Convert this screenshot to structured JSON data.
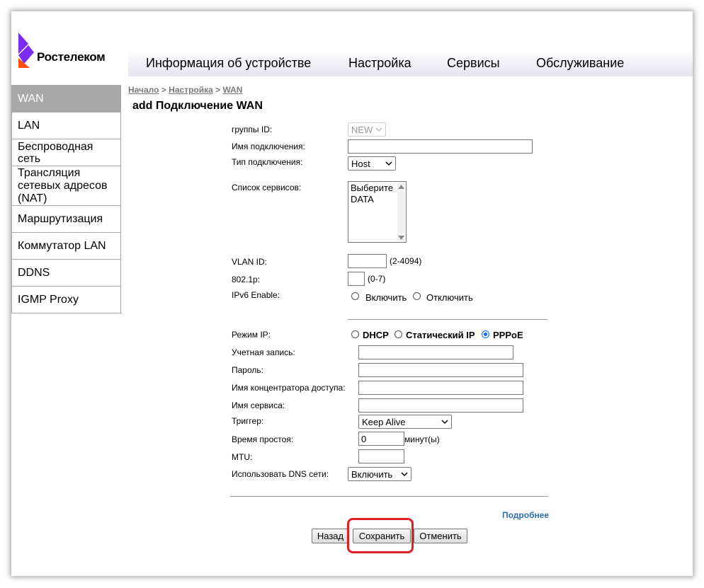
{
  "brand": {
    "name": "Ростелеком",
    "accent": "#7B2CF0",
    "secondary": "#FF4F12"
  },
  "topnav": [
    "Информация об устройстве",
    "Настройка",
    "Сервисы",
    "Обслуживание"
  ],
  "sidebar": [
    "WAN",
    "LAN",
    "Беспроводная сеть",
    "Трансляция сетевых адресов (NAT)",
    "Маршрутизация",
    "Коммутатор LAN",
    "DDNS",
    "IGMP Proxy"
  ],
  "breadcrumb": {
    "home": "Начало",
    "sep1": " > ",
    "settings": "Настройка",
    "sep2": " > ",
    "current": "WAN"
  },
  "page_title": "add Подключение WAN",
  "form": {
    "group_id_label": "группы ID:",
    "group_id_value": "NEW",
    "conn_name_label": "Имя подключения:",
    "conn_name_value": "",
    "conn_type_label": "Тип подключения:",
    "conn_type_value": "Host",
    "service_list_label": "Список сервисов:",
    "service_list_options": [
      "Выберите",
      "DATA"
    ],
    "vlan_label": "VLAN ID:",
    "vlan_value": "",
    "vlan_hint": "(2-4094)",
    "p8021_label": "802.1p:",
    "p8021_value": "",
    "p8021_hint": "(0-7)",
    "ipv6_label": "IPv6 Enable:",
    "ipv6_on": "Включить",
    "ipv6_off": "Отключить",
    "ip_mode_label": "Режим IP:",
    "ip_mode_options": [
      "DHCP",
      "Статический IP",
      "PPPoE"
    ],
    "ip_mode_selected": "PPPoE",
    "account_label": "Учетная запись:",
    "password_label": "Пароль:",
    "ac_name_label": "Имя концентратора доступа:",
    "service_name_label": "Имя сервиса:",
    "trigger_label": "Триггер:",
    "trigger_value": "Keep Alive",
    "idle_label": "Время простоя:",
    "idle_value": "0",
    "idle_unit": "минут(ы)",
    "mtu_label": "MTU:",
    "mtu_value": "",
    "dns_label": "Использовать DNS сети:",
    "dns_value": "Включить"
  },
  "more_link": "Подробнее",
  "buttons": {
    "back": "Назад",
    "save": "Сохранить",
    "cancel": "Отменить"
  },
  "highlight_color": "#E01E26"
}
